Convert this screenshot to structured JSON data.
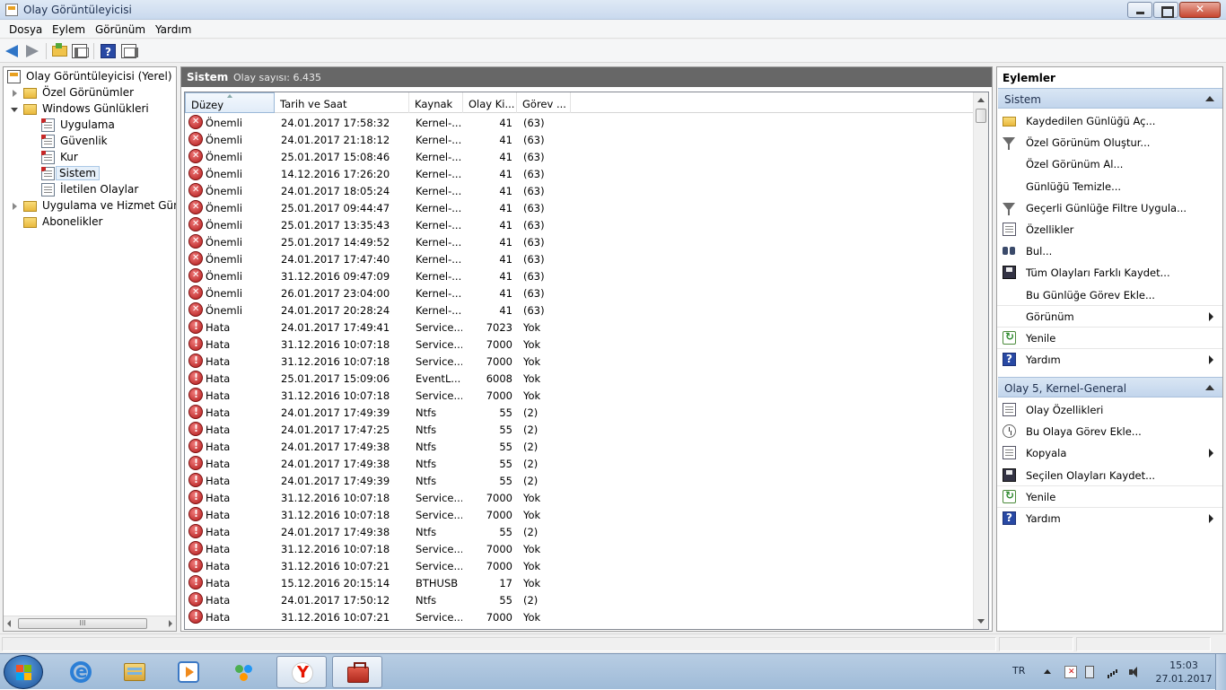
{
  "window": {
    "title": "Olay Görüntüleyicisi"
  },
  "menu": [
    "Dosya",
    "Eylem",
    "Görünüm",
    "Yardım"
  ],
  "tree": {
    "root": "Olay Görüntüleyicisi (Yerel)",
    "custom_views": "Özel Görünümler",
    "windows_logs": "Windows Günlükleri",
    "logs": [
      "Uygulama",
      "Güvenlik",
      "Kur",
      "Sistem",
      "İletilen Olaylar"
    ],
    "app_service_logs": "Uygulama ve Hizmet Günlükleri",
    "subscriptions": "Abonelikler"
  },
  "center": {
    "title": "Sistem",
    "event_count": "Olay sayısı: 6.435",
    "columns": [
      "Düzey",
      "Tarih ve Saat",
      "Kaynak",
      "Olay Ki...",
      "Görev ..."
    ],
    "rows": [
      {
        "level": "Önemli",
        "type": "critical",
        "date": "24.01.2017 17:58:32",
        "source": "Kernel-...",
        "id": "41",
        "task": "(63)"
      },
      {
        "level": "Önemli",
        "type": "critical",
        "date": "24.01.2017 21:18:12",
        "source": "Kernel-...",
        "id": "41",
        "task": "(63)"
      },
      {
        "level": "Önemli",
        "type": "critical",
        "date": "25.01.2017 15:08:46",
        "source": "Kernel-...",
        "id": "41",
        "task": "(63)"
      },
      {
        "level": "Önemli",
        "type": "critical",
        "date": "14.12.2016 17:26:20",
        "source": "Kernel-...",
        "id": "41",
        "task": "(63)"
      },
      {
        "level": "Önemli",
        "type": "critical",
        "date": "24.01.2017 18:05:24",
        "source": "Kernel-...",
        "id": "41",
        "task": "(63)"
      },
      {
        "level": "Önemli",
        "type": "critical",
        "date": "25.01.2017 09:44:47",
        "source": "Kernel-...",
        "id": "41",
        "task": "(63)"
      },
      {
        "level": "Önemli",
        "type": "critical",
        "date": "25.01.2017 13:35:43",
        "source": "Kernel-...",
        "id": "41",
        "task": "(63)"
      },
      {
        "level": "Önemli",
        "type": "critical",
        "date": "25.01.2017 14:49:52",
        "source": "Kernel-...",
        "id": "41",
        "task": "(63)"
      },
      {
        "level": "Önemli",
        "type": "critical",
        "date": "24.01.2017 17:47:40",
        "source": "Kernel-...",
        "id": "41",
        "task": "(63)"
      },
      {
        "level": "Önemli",
        "type": "critical",
        "date": "31.12.2016 09:47:09",
        "source": "Kernel-...",
        "id": "41",
        "task": "(63)"
      },
      {
        "level": "Önemli",
        "type": "critical",
        "date": "26.01.2017 23:04:00",
        "source": "Kernel-...",
        "id": "41",
        "task": "(63)"
      },
      {
        "level": "Önemli",
        "type": "critical",
        "date": "24.01.2017 20:28:24",
        "source": "Kernel-...",
        "id": "41",
        "task": "(63)"
      },
      {
        "level": "Hata",
        "type": "error",
        "date": "24.01.2017 17:49:41",
        "source": "Service...",
        "id": "7023",
        "task": "Yok"
      },
      {
        "level": "Hata",
        "type": "error",
        "date": "31.12.2016 10:07:18",
        "source": "Service...",
        "id": "7000",
        "task": "Yok"
      },
      {
        "level": "Hata",
        "type": "error",
        "date": "31.12.2016 10:07:18",
        "source": "Service...",
        "id": "7000",
        "task": "Yok"
      },
      {
        "level": "Hata",
        "type": "error",
        "date": "25.01.2017 15:09:06",
        "source": "EventL...",
        "id": "6008",
        "task": "Yok"
      },
      {
        "level": "Hata",
        "type": "error",
        "date": "31.12.2016 10:07:18",
        "source": "Service...",
        "id": "7000",
        "task": "Yok"
      },
      {
        "level": "Hata",
        "type": "error",
        "date": "24.01.2017 17:49:39",
        "source": "Ntfs",
        "id": "55",
        "task": "(2)"
      },
      {
        "level": "Hata",
        "type": "error",
        "date": "24.01.2017 17:47:25",
        "source": "Ntfs",
        "id": "55",
        "task": "(2)"
      },
      {
        "level": "Hata",
        "type": "error",
        "date": "24.01.2017 17:49:38",
        "source": "Ntfs",
        "id": "55",
        "task": "(2)"
      },
      {
        "level": "Hata",
        "type": "error",
        "date": "24.01.2017 17:49:38",
        "source": "Ntfs",
        "id": "55",
        "task": "(2)"
      },
      {
        "level": "Hata",
        "type": "error",
        "date": "24.01.2017 17:49:39",
        "source": "Ntfs",
        "id": "55",
        "task": "(2)"
      },
      {
        "level": "Hata",
        "type": "error",
        "date": "31.12.2016 10:07:18",
        "source": "Service...",
        "id": "7000",
        "task": "Yok"
      },
      {
        "level": "Hata",
        "type": "error",
        "date": "31.12.2016 10:07:18",
        "source": "Service...",
        "id": "7000",
        "task": "Yok"
      },
      {
        "level": "Hata",
        "type": "error",
        "date": "24.01.2017 17:49:38",
        "source": "Ntfs",
        "id": "55",
        "task": "(2)"
      },
      {
        "level": "Hata",
        "type": "error",
        "date": "31.12.2016 10:07:18",
        "source": "Service...",
        "id": "7000",
        "task": "Yok"
      },
      {
        "level": "Hata",
        "type": "error",
        "date": "31.12.2016 10:07:21",
        "source": "Service...",
        "id": "7000",
        "task": "Yok"
      },
      {
        "level": "Hata",
        "type": "error",
        "date": "15.12.2016 20:15:14",
        "source": "BTHUSB",
        "id": "17",
        "task": "Yok"
      },
      {
        "level": "Hata",
        "type": "error",
        "date": "24.01.2017 17:50:12",
        "source": "Ntfs",
        "id": "55",
        "task": "(2)"
      },
      {
        "level": "Hata",
        "type": "error",
        "date": "31.12.2016 10:07:21",
        "source": "Service...",
        "id": "7000",
        "task": "Yok"
      }
    ]
  },
  "actions": {
    "title": "Eylemler",
    "section1": {
      "title": "Sistem",
      "items": [
        {
          "label": "Kaydedilen Günlüğü Aç...",
          "icon": "open-folder-icon"
        },
        {
          "label": "Özel Görünüm Oluştur...",
          "icon": "filter-icon"
        },
        {
          "label": "Özel Görünüm Al...",
          "icon": ""
        },
        {
          "label": "Günlüğü Temizle...",
          "icon": ""
        },
        {
          "label": "Geçerli Günlüğe Filtre Uygula...",
          "icon": "filter-icon"
        },
        {
          "label": "Özellikler",
          "icon": "properties-icon"
        },
        {
          "label": "Bul...",
          "icon": "binoculars-icon"
        },
        {
          "label": "Tüm Olayları Farklı Kaydet...",
          "icon": "save-icon"
        },
        {
          "label": "Bu Günlüğe Görev Ekle...",
          "icon": ""
        },
        {
          "label": "Görünüm",
          "icon": "",
          "submenu": true
        },
        {
          "label": "Yenile",
          "icon": "refresh-icon"
        },
        {
          "label": "Yardım",
          "icon": "help-icon",
          "submenu": true
        }
      ]
    },
    "section2": {
      "title": "Olay 5, Kernel-General",
      "items": [
        {
          "label": "Olay Özellikleri",
          "icon": "properties-icon"
        },
        {
          "label": "Bu Olaya Görev Ekle...",
          "icon": "task-icon"
        },
        {
          "label": "Kopyala",
          "icon": "copy-icon",
          "submenu": true
        },
        {
          "label": "Seçilen Olayları Kaydet...",
          "icon": "save-icon"
        },
        {
          "label": "Yenile",
          "icon": "refresh-icon"
        },
        {
          "label": "Yardım",
          "icon": "help-icon",
          "submenu": true
        }
      ]
    }
  },
  "taskbar": {
    "lang": "TR",
    "time": "15:03",
    "date": "27.01.2017"
  },
  "colors": {
    "accent": "#2f75c7",
    "critical": "#b01919",
    "header_bar": "#676767"
  }
}
